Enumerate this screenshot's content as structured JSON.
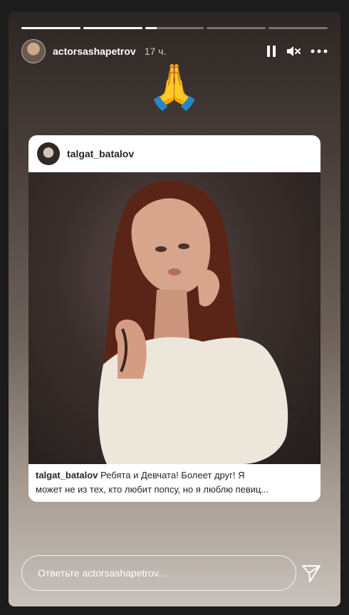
{
  "story": {
    "progress": [
      1,
      1,
      0.2,
      0,
      0
    ],
    "author": {
      "username": "actorsashapetrov",
      "time": "17 ч."
    },
    "sticker": "🙏",
    "post": {
      "username": "talgat_batalov",
      "caption_user": "talgat_batalov",
      "caption_line1": "Ребята и Девчата! Болеет друг!  Я",
      "caption_line2": "может  не из тех, кто любит попсу, но я люблю певиц..."
    },
    "reply_placeholder": "Ответьте actorsashapetrov..."
  },
  "icons": {
    "pause": "pause-icon",
    "mute": "speaker-muted-icon",
    "more": "more-horizontal-icon",
    "send": "paper-plane-icon"
  }
}
